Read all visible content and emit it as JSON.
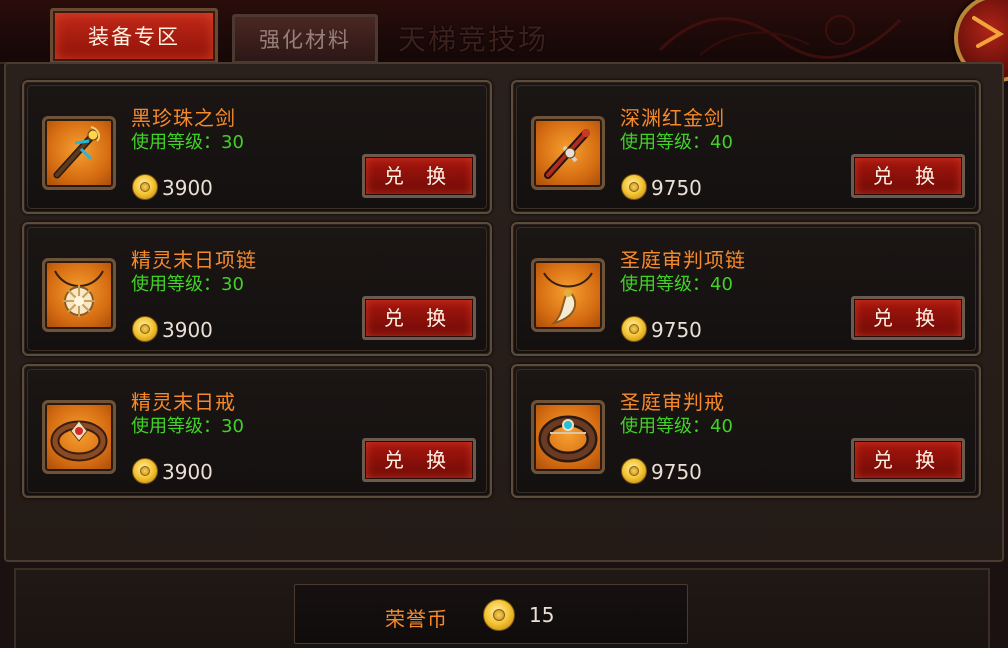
{
  "tabs": {
    "equipment": "装备专区",
    "materials": "强化材料",
    "arena": "天梯竞技场"
  },
  "exchange_label": "兑 换",
  "items": [
    {
      "name": "黑珍珠之剑",
      "level": "使用等级：30",
      "price": "3900",
      "icon": "sword-icon"
    },
    {
      "name": "深渊红金剑",
      "level": "使用等级：40",
      "price": "9750",
      "icon": "sword-icon"
    },
    {
      "name": "精灵末日项链",
      "level": "使用等级：30",
      "price": "3900",
      "icon": "necklace-icon"
    },
    {
      "name": "圣庭审判项链",
      "level": "使用等级：40",
      "price": "9750",
      "icon": "necklace-icon"
    },
    {
      "name": "精灵末日戒",
      "level": "使用等级：30",
      "price": "3900",
      "icon": "ring-icon"
    },
    {
      "name": "圣庭审判戒",
      "level": "使用等级：40",
      "price": "9750",
      "icon": "ring-icon"
    }
  ],
  "currency": {
    "label": "荣誉币",
    "value": "15",
    "icon": "coin-icon"
  },
  "colors": {
    "item_name": "#f6892a",
    "level_text": "#40d226",
    "active_tab": "#b0200f"
  }
}
